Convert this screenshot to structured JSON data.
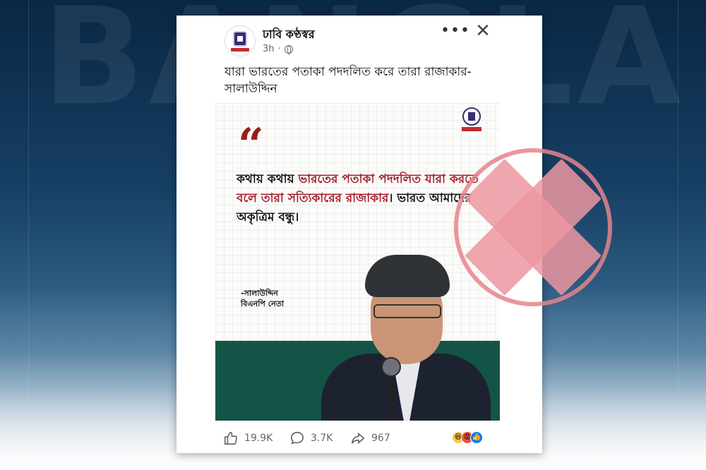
{
  "background": {
    "watermark": "BANGLA",
    "colors": {
      "top": "#0a2744",
      "bottom": "#f4f7fa"
    }
  },
  "post": {
    "page_name": "ঢাবি কণ্ঠস্বর",
    "time_ago": "3h",
    "caption": "যারা ভারতের পতাকা পদদলিত করে তারা রাজাকার- সালাউদ্দিন",
    "image": {
      "quote_mark": "“",
      "quote_parts": [
        {
          "text": "কথায় কথায় ",
          "color": "#111111"
        },
        {
          "text": "ভারতের পতাকা পদদলিত যারা করতে বলে তারা সত্যিকারের রাজাকার",
          "color": "#a71d2a"
        },
        {
          "text": "। ভারত আমাদের অকৃত্রিম বন্ধু।",
          "color": "#111111"
        }
      ],
      "attribution_name": "-সালাউদ্দিন",
      "attribution_title": "বিএনপি নেতা"
    },
    "reactions": {
      "likes": "19.9K",
      "comments": "3.7K",
      "shares": "967",
      "emoji_icons": [
        "haha-icon",
        "angry-icon",
        "like-icon"
      ]
    }
  },
  "overlay": {
    "verdict_icon": "cross-icon",
    "verdict_color": "#e8828c"
  }
}
